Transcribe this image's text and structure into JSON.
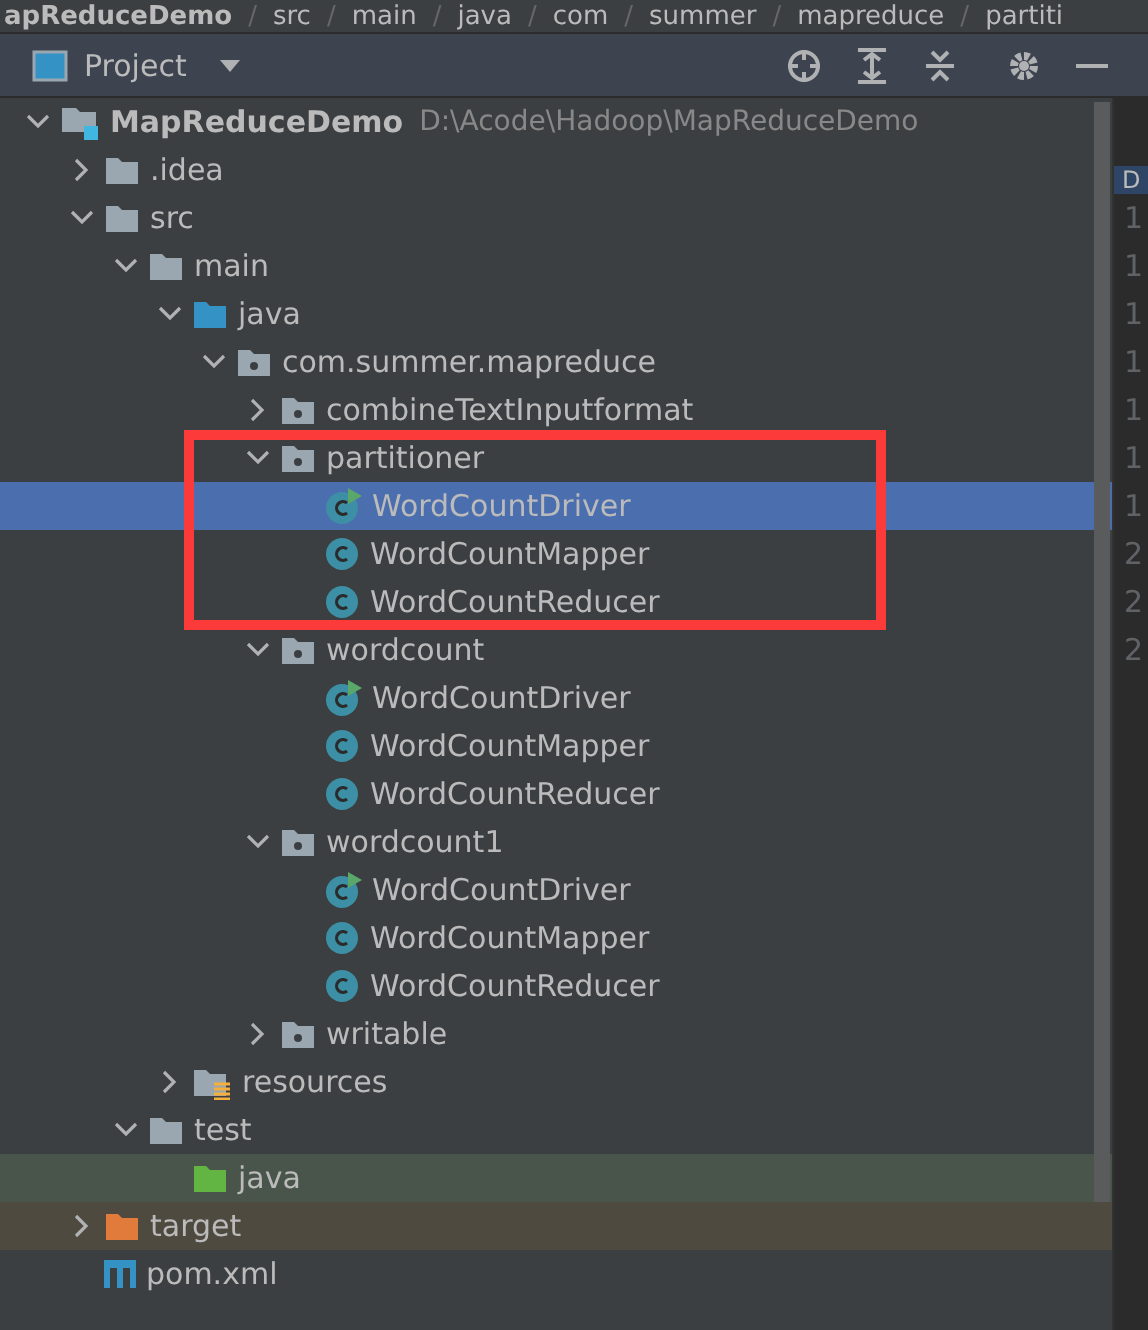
{
  "breadcrumb": [
    {
      "label": "apReduceDemo"
    },
    {
      "separator": "/",
      "label": "src"
    },
    {
      "separator": "/",
      "label": "main"
    },
    {
      "separator": "/",
      "label": "java"
    },
    {
      "separator": "/",
      "label": "com"
    },
    {
      "separator": "/",
      "label": "summer"
    },
    {
      "separator": "/",
      "label": "mapreduce"
    },
    {
      "separator": "/",
      "label": "partiti"
    }
  ],
  "panel": {
    "title": "Project"
  },
  "tree": [
    {
      "label": "MapReduceDemo",
      "path": "D:\\Acode\\Hadoop\\MapReduceDemo",
      "kind": "module",
      "expanded": true,
      "selected": false,
      "children": [
        {
          "label": ".idea",
          "kind": "folder",
          "expanded": false,
          "selected": false
        },
        {
          "label": "src",
          "kind": "folder",
          "expanded": true,
          "selected": false,
          "children": [
            {
              "label": "main",
              "kind": "folder",
              "expanded": true,
              "selected": false,
              "children": [
                {
                  "label": "java",
                  "kind": "source",
                  "expanded": true,
                  "selected": false,
                  "children": [
                    {
                      "label": "com.summer.mapreduce",
                      "kind": "package",
                      "expanded": true,
                      "selected": false,
                      "children": [
                        {
                          "label": "combineTextInputformat",
                          "kind": "package",
                          "expanded": false,
                          "selected": false
                        },
                        {
                          "label": "partitioner",
                          "kind": "package",
                          "expanded": true,
                          "selected": false,
                          "highlighted": true,
                          "children": [
                            {
                              "label": "WordCountDriver",
                              "kind": "runnable-class",
                              "selected": true
                            },
                            {
                              "label": "WordCountMapper",
                              "kind": "class",
                              "selected": false
                            },
                            {
                              "label": "WordCountReducer",
                              "kind": "class",
                              "selected": false
                            }
                          ]
                        },
                        {
                          "label": "wordcount",
                          "kind": "package",
                          "expanded": true,
                          "selected": false,
                          "children": [
                            {
                              "label": "WordCountDriver",
                              "kind": "runnable-class",
                              "selected": false
                            },
                            {
                              "label": "WordCountMapper",
                              "kind": "class",
                              "selected": false
                            },
                            {
                              "label": "WordCountReducer",
                              "kind": "class",
                              "selected": false
                            }
                          ]
                        },
                        {
                          "label": "wordcount1",
                          "kind": "package",
                          "expanded": true,
                          "selected": false,
                          "children": [
                            {
                              "label": "WordCountDriver",
                              "kind": "runnable-class",
                              "selected": false
                            },
                            {
                              "label": "WordCountMapper",
                              "kind": "class",
                              "selected": false
                            },
                            {
                              "label": "WordCountReducer",
                              "kind": "class",
                              "selected": false
                            }
                          ]
                        },
                        {
                          "label": "writable",
                          "kind": "package",
                          "expanded": false,
                          "selected": false
                        }
                      ]
                    }
                  ]
                },
                {
                  "label": "resources",
                  "kind": "resources",
                  "expanded": false,
                  "selected": false
                }
              ]
            },
            {
              "label": "test",
              "kind": "folder",
              "expanded": true,
              "selected": false,
              "children": [
                {
                  "label": "java",
                  "kind": "test-source",
                  "selected": false
                }
              ]
            }
          ]
        },
        {
          "label": "target",
          "kind": "excluded",
          "expanded": false,
          "selected": false
        },
        {
          "label": "pom.xml",
          "kind": "maven",
          "selected": false
        }
      ]
    }
  ],
  "editor": {
    "tab": "D",
    "line_numbers": [
      "1",
      "1",
      "1",
      "1",
      "1",
      "1",
      "1",
      "2",
      "2",
      "2"
    ]
  }
}
